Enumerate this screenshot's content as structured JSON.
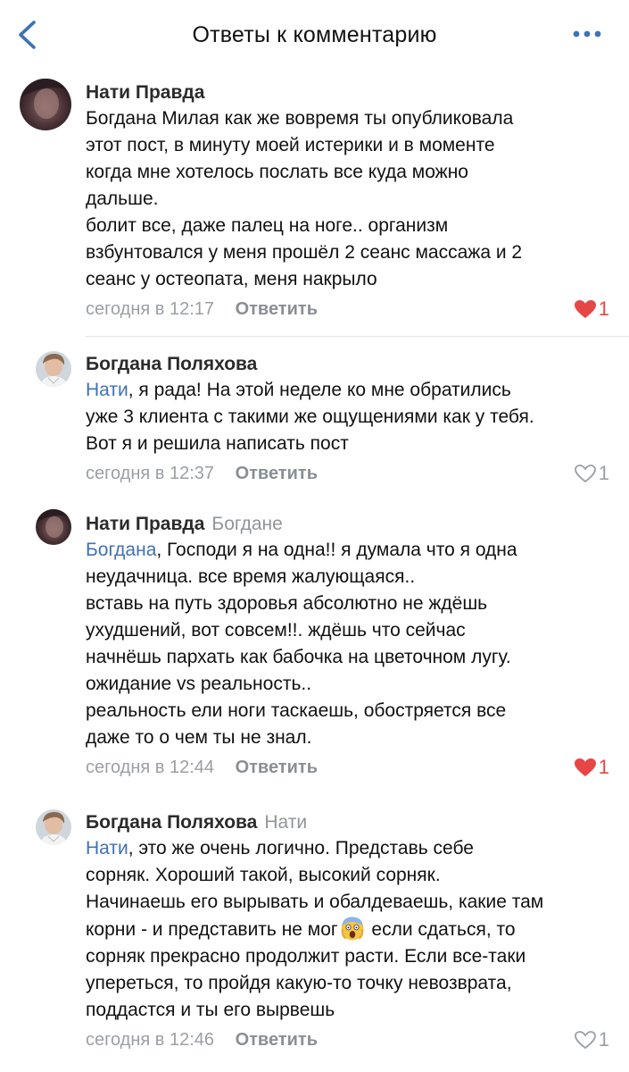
{
  "header": {
    "title": "Ответы к комментарию"
  },
  "comments": [
    {
      "author": "Нати Правда",
      "reply_to": "",
      "mention": "",
      "body_lines": [
        "Богдана Милая как же вовремя ты опубликовала",
        "этот пост, в минуту моей истерики и в моменте",
        "когда мне хотелось послать все куда можно",
        "дальше.",
        "болит все, даже палец на ноге.. организм",
        "взбунтовался у меня прошёл 2 сеанс массажа и 2",
        "сеанс у остеопата, меня накрыло"
      ],
      "time": "сегодня в 12:17",
      "reply_label": "Ответить",
      "likes": "1",
      "liked": true
    },
    {
      "author": "Богдана Поляхова",
      "reply_to": "",
      "mention": "Нати",
      "first_line_rest": ", я рада! На этой неделе ко мне обратились",
      "body_lines": [
        "уже 3 клиента с такими же ощущениями как у тебя.",
        "Вот я и решила написать пост"
      ],
      "time": "сегодня в 12:37",
      "reply_label": "Ответить",
      "likes": "1",
      "liked": false
    },
    {
      "author": "Нати Правда",
      "reply_to": "Богдане",
      "mention": "Богдана",
      "first_line_rest": ", Господи я на одна!! я думала что я одна",
      "body_lines": [
        "неудачница. все время жалующаяся..",
        "вставь на путь здоровья абсолютно не ждёшь",
        "ухудшений, вот совсем!!. ждёшь что сейчас",
        "начнёшь пархать как бабочка на цветочном лугу.",
        "ожидание vs реальность..",
        "реальность ели ноги таскаешь, обостряется все",
        "даже то о чем ты не знал."
      ],
      "time": "сегодня в 12:44",
      "reply_label": "Ответить",
      "likes": "1",
      "liked": true
    },
    {
      "author": "Богдана Поляхова",
      "reply_to": "Нати",
      "mention": "Нати",
      "first_line_rest": ", это же очень логично. Представь себе",
      "body_lines": [
        "сорняк. Хороший такой, высокий сорняк.",
        "Начинаешь его вырывать и обалдеваешь, какие там"
      ],
      "emoji_line_before": "корни - и представить не мог",
      "emoji_line_after": " если сдаться, то",
      "emoji_name": "screaming-face-emoji",
      "body_lines_tail": [
        "сорняк прекрасно продолжит расти. Если все-таки",
        "упереться, то пройдя какую-то точку невозврата,",
        "поддастся и ты его вырвешь"
      ],
      "time": "сегодня в 12:46",
      "reply_label": "Ответить",
      "likes": "1",
      "liked": false
    }
  ],
  "icons": {
    "back": "chevron-left-icon",
    "more": "more-dots-icon",
    "like_active": "heart-filled-icon",
    "like_inactive": "heart-outline-icon"
  },
  "colors": {
    "accent": "#3f72b5",
    "like_red": "#e64646",
    "secondary_text": "#9b9fa4"
  }
}
